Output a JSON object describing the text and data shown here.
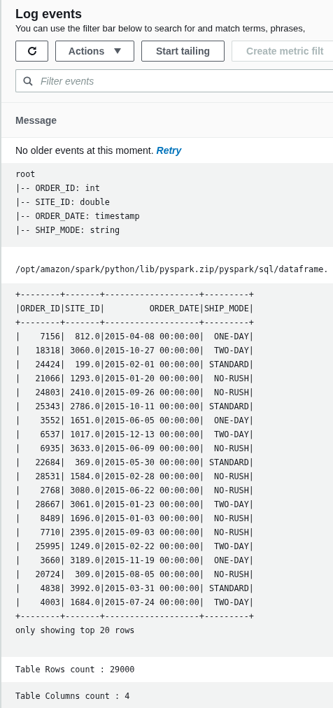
{
  "header": {
    "title": "Log events",
    "description": "You can use the filter bar below to search for and match terms, phrases,"
  },
  "toolbar": [
    {
      "kind": "refresh",
      "disabled": false
    },
    {
      "kind": "dropdown",
      "label": "Actions",
      "disabled": false
    },
    {
      "kind": "text",
      "label": "Start tailing",
      "disabled": false
    },
    {
      "kind": "text",
      "label": "Create metric filt",
      "disabled": true
    }
  ],
  "search": {
    "placeholder": "Filter events"
  },
  "table": {
    "column": "Message"
  },
  "events": [
    {
      "kind": "notice",
      "text": "No older events at this moment.",
      "link": "Retry"
    },
    {
      "kind": "log",
      "lines": [
        "root",
        "|-- ORDER_ID: int",
        "|-- SITE_ID: double",
        "|-- ORDER_DATE: timestamp",
        "|-- SHIP_MODE: string"
      ]
    },
    {
      "kind": "log",
      "lines": [
        "/opt/amazon/spark/python/lib/pyspark.zip/pyspark/sql/dataframe."
      ]
    },
    {
      "kind": "log",
      "lines": [
        "+--------+-------+-------------------+---------+",
        "|ORDER_ID|SITE_ID|         ORDER_DATE|SHIP_MODE|",
        "+--------+-------+-------------------+---------+",
        "|    7156|  812.0|2015-04-08 00:00:00|  ONE-DAY|",
        "|   18318| 3060.0|2015-10-27 00:00:00|  TWO-DAY|",
        "|   24424|  199.0|2015-02-01 00:00:00| STANDARD|",
        "|   21066| 1293.0|2015-01-20 00:00:00|  NO-RUSH|",
        "|   24803| 2410.0|2015-09-26 00:00:00|  NO-RUSH|",
        "|   25343| 2786.0|2015-10-11 00:00:00| STANDARD|",
        "|    3552| 1651.0|2015-06-05 00:00:00|  ONE-DAY|",
        "|    6537| 1017.0|2015-12-13 00:00:00|  TWO-DAY|",
        "|    6935| 3633.0|2015-06-09 00:00:00|  NO-RUSH|",
        "|   22684|  369.0|2015-05-30 00:00:00| STANDARD|",
        "|   28531| 1584.0|2015-02-28 00:00:00|  NO-RUSH|",
        "|    2768| 3080.0|2015-06-22 00:00:00|  NO-RUSH|",
        "|   28667| 3061.0|2015-01-23 00:00:00|  TWO-DAY|",
        "|    8489| 1696.0|2015-01-03 00:00:00|  NO-RUSH|",
        "|    7710| 2395.0|2015-09-03 00:00:00|  NO-RUSH|",
        "|   25995| 1249.0|2015-02-22 00:00:00|  TWO-DAY|",
        "|    3660| 3189.0|2015-11-19 00:00:00|  ONE-DAY|",
        "|   20724|  309.0|2015-08-05 00:00:00|  NO-RUSH|",
        "|    4838| 3992.0|2015-03-31 00:00:00| STANDARD|",
        "|    4003| 1684.0|2015-07-24 00:00:00|  TWO-DAY|",
        "+--------+-------+-------------------+---------+",
        "only showing top 20 rows"
      ]
    },
    {
      "kind": "log",
      "lines": [
        "Table Rows count : 29000"
      ]
    },
    {
      "kind": "log",
      "lines": [
        "Table Columns count : 4"
      ]
    }
  ]
}
